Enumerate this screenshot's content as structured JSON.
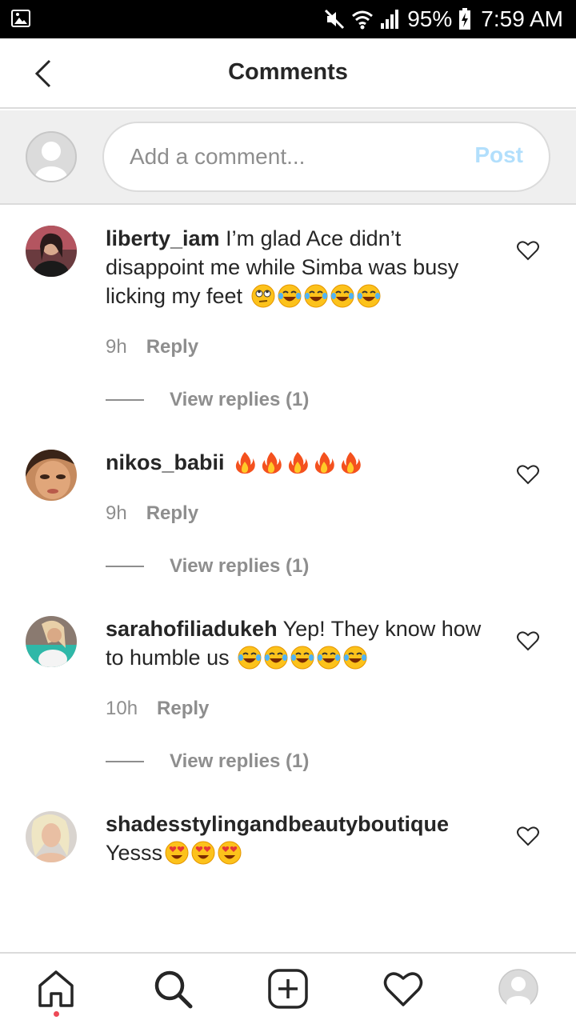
{
  "status_bar": {
    "battery": "95%",
    "time": "7:59 AM"
  },
  "header": {
    "title": "Comments"
  },
  "composer": {
    "placeholder": "Add a comment...",
    "post_label": "Post"
  },
  "comments": [
    {
      "username": "liberty_iam",
      "text": "I’m glad Ace didn’t disappoint me while Simba was busy licking my feet",
      "emojis": [
        "eye-roll",
        "laugh",
        "laugh",
        "laugh",
        "laugh"
      ],
      "time": "9h",
      "reply_label": "Reply",
      "view_replies": "View replies (1)"
    },
    {
      "username": "nikos_babii",
      "text": "",
      "emojis": [
        "fire",
        "fire",
        "fire",
        "fire",
        "fire"
      ],
      "time": "9h",
      "reply_label": "Reply",
      "view_replies": "View replies (1)"
    },
    {
      "username": "sarahofiliadukeh",
      "text": "Yep! They know how to humble us",
      "emojis": [
        "laugh",
        "laugh",
        "laugh",
        "laugh",
        "laugh"
      ],
      "time": "10h",
      "reply_label": "Reply",
      "view_replies": "View replies (1)"
    },
    {
      "username": "shadesstylingandbeautyboutique",
      "text": "Yesss",
      "emojis": [
        "heart-eyes",
        "heart-eyes",
        "heart-eyes"
      ],
      "time": "",
      "reply_label": "",
      "view_replies": ""
    }
  ],
  "bottom_nav": [
    "home-icon",
    "search-icon",
    "add-post-icon",
    "activity-heart-icon",
    "profile-icon"
  ],
  "colors": {
    "post_disabled": "#b2dffc",
    "secondary_text": "#8e8e8e",
    "notification_dot": "#ed4956"
  }
}
